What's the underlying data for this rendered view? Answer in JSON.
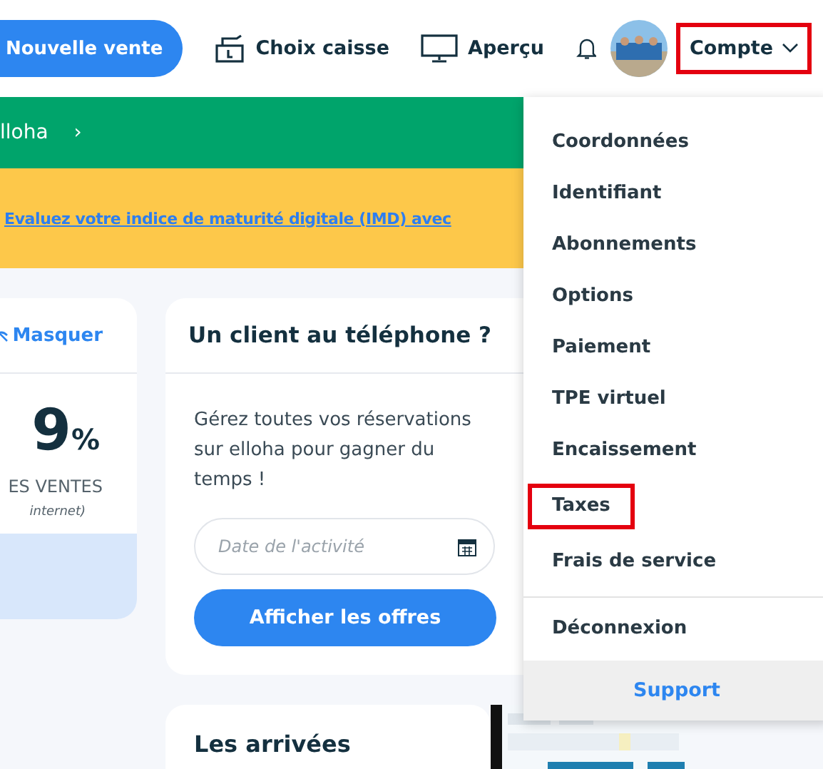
{
  "header": {
    "new_sale": "Nouvelle vente",
    "register": "Choix caisse",
    "preview": "Aperçu",
    "account": {
      "label": "Compte",
      "highlighted": true,
      "expanded": true
    }
  },
  "green_banner": {
    "text": "lloha",
    "arrow": "›"
  },
  "yellow_banner": {
    "link": "Evaluez votre indice de maturité digitale (IMD) avec"
  },
  "stats_card": {
    "hide": "Masquer",
    "value": "9",
    "unit": "%",
    "label": "ES VENTES",
    "note": "internet)"
  },
  "phone_card": {
    "title": "Un client au téléphone ?",
    "text": "Gérez toutes vos réservations sur elloha pour gagner du temps !",
    "date_field": {
      "placeholder": "Date de l'activité"
    },
    "button": "Afficher les offres"
  },
  "arrivals_card": {
    "title": "Les arrivées"
  },
  "account_menu": {
    "items": [
      {
        "label": "Coordonnées",
        "highlighted": false
      },
      {
        "label": "Identifiant",
        "highlighted": false
      },
      {
        "label": "Abonnements",
        "highlighted": false
      },
      {
        "label": "Options",
        "highlighted": false
      },
      {
        "label": "Paiement",
        "highlighted": false
      },
      {
        "label": "TPE virtuel",
        "highlighted": false
      },
      {
        "label": "Encaissement",
        "highlighted": false
      },
      {
        "label": "Taxes",
        "highlighted": true
      },
      {
        "label": "Frais de service",
        "highlighted": false
      }
    ],
    "logout": "Déconnexion",
    "support": "Support"
  }
}
